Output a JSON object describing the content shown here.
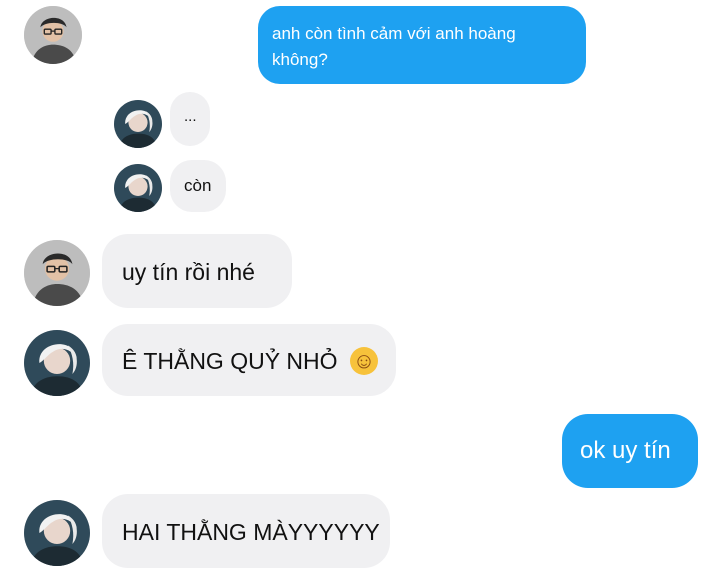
{
  "colors": {
    "outgoing_bubble": "#1ea1f1",
    "incoming_bubble": "#f0f0f2",
    "background": "#ffffff"
  },
  "messages": [
    {
      "sender": "other",
      "avatar": "avatar-glasses-icon",
      "text": ""
    },
    {
      "sender": "me",
      "text": "anh còn tình cảm với anh hoàng không?"
    },
    {
      "sender": "other",
      "avatar": "avatar-white-hair-icon",
      "text": "..."
    },
    {
      "sender": "other",
      "avatar": "avatar-white-hair-icon",
      "text": "còn"
    },
    {
      "sender": "other",
      "avatar": "avatar-glasses-icon",
      "text": "uy tín rồi nhé"
    },
    {
      "sender": "other",
      "avatar": "avatar-white-hair-icon",
      "text": "Ê THẰNG QUỶ NHỎ",
      "emoji": "☺"
    },
    {
      "sender": "me",
      "text": "ok uy tín"
    },
    {
      "sender": "other",
      "avatar": "avatar-white-hair-icon",
      "text": "HAI THẰNG MÀYYYYYY"
    }
  ]
}
